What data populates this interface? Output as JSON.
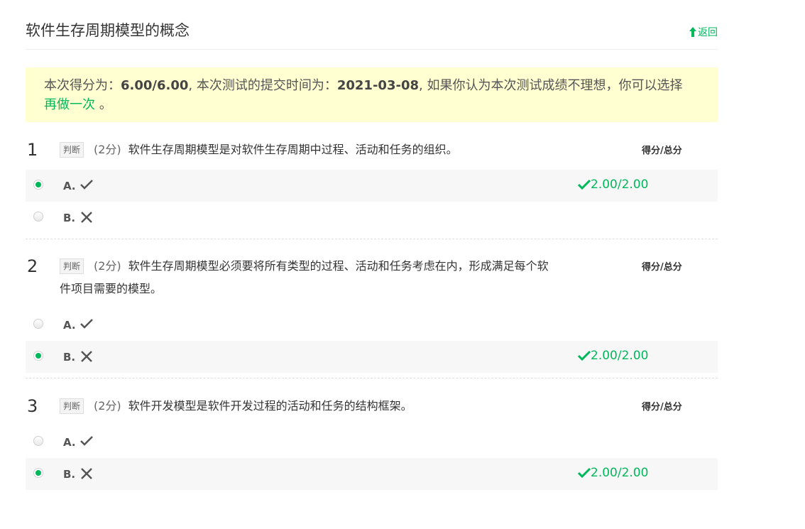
{
  "page": {
    "title": "软件生存周期模型的概念",
    "back_label": "返回"
  },
  "notice": {
    "prefix": "本次得分为：",
    "score": "6.00/6.00",
    "mid": ", 本次测试的提交时间为：",
    "date": "2021-03-08",
    "suffix": ", 如果你认为本次测试成绩不理想，你可以选择 ",
    "redo": "再做一次",
    "end": " 。"
  },
  "colors": {
    "accent": "#00b85c",
    "notice_bg": "#ffffd2"
  },
  "questions": [
    {
      "number": "1",
      "type": "判断",
      "points": "(2分)",
      "text": "软件生存周期模型是对软件生存周期中过程、活动和任务的组织。",
      "score_header": "得分/总分",
      "options": [
        {
          "label": "A.",
          "icon": "check-icon",
          "selected": true,
          "score": "2.00/2.00"
        },
        {
          "label": "B.",
          "icon": "cross-icon",
          "selected": false,
          "score": ""
        }
      ]
    },
    {
      "number": "2",
      "type": "判断",
      "points": "(2分)",
      "text": "软件生存周期模型必须要将所有类型的过程、活动和任务考虑在内，形成满足每个软件项目需要的模型。",
      "score_header": "得分/总分",
      "options": [
        {
          "label": "A.",
          "icon": "check-icon",
          "selected": false,
          "score": ""
        },
        {
          "label": "B.",
          "icon": "cross-icon",
          "selected": true,
          "score": "2.00/2.00"
        }
      ]
    },
    {
      "number": "3",
      "type": "判断",
      "points": "(2分)",
      "text": "软件开发模型是软件开发过程的活动和任务的结构框架。",
      "score_header": "得分/总分",
      "options": [
        {
          "label": "A.",
          "icon": "check-icon",
          "selected": false,
          "score": ""
        },
        {
          "label": "B.",
          "icon": "cross-icon",
          "selected": true,
          "score": "2.00/2.00"
        }
      ]
    }
  ]
}
